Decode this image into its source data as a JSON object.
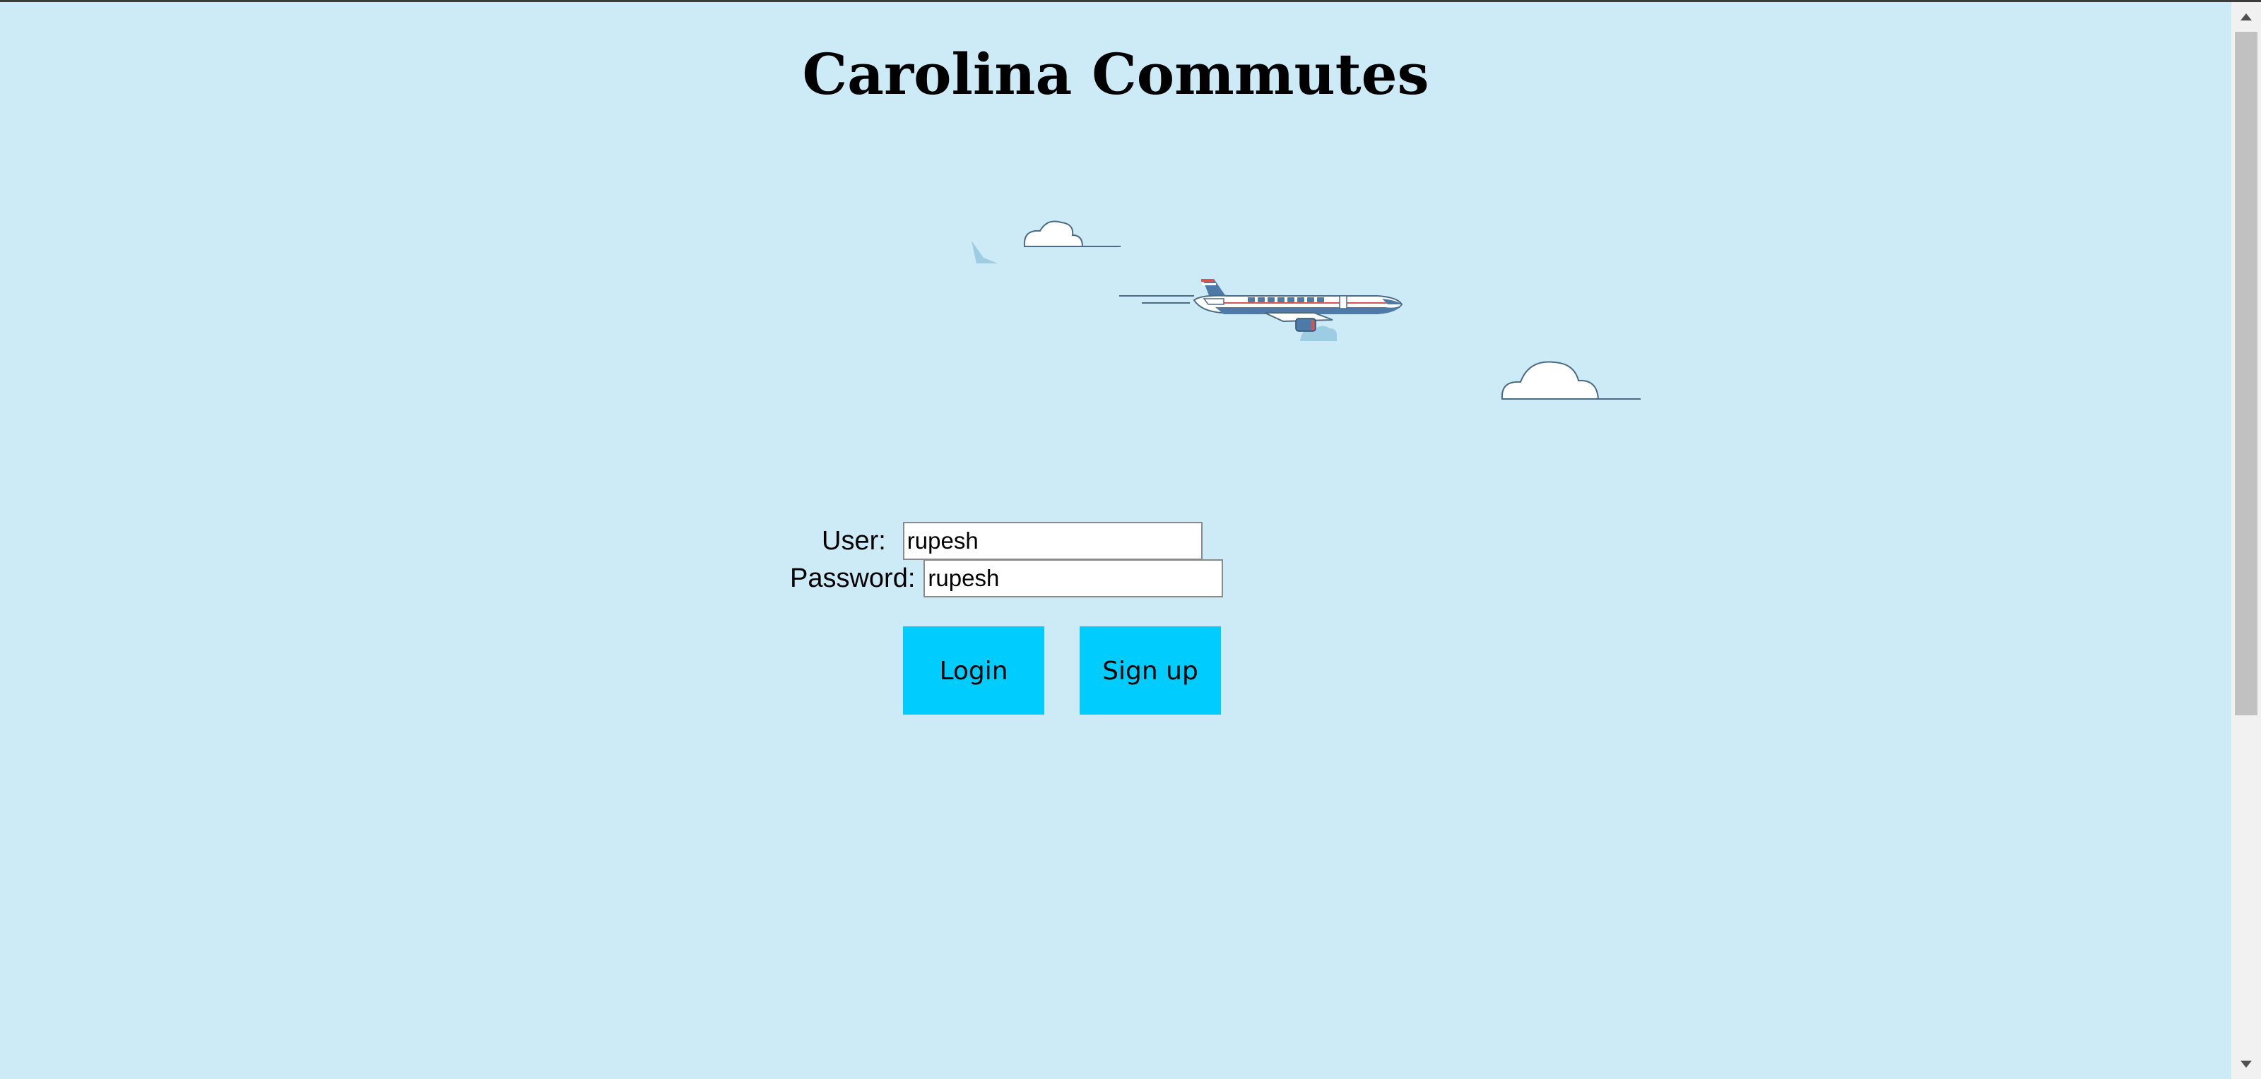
{
  "page": {
    "title": "Carolina Commutes",
    "background_color": "#cdeaf7"
  },
  "illustration": {
    "icons": [
      "bird-icon",
      "cloud-icon",
      "airplane-icon",
      "cloud-icon"
    ]
  },
  "login_form": {
    "user_label": "User:",
    "user_value": "rupesh",
    "password_label": "Password:",
    "password_value": "rupesh",
    "login_button": "Login",
    "signup_button": "Sign up",
    "button_color": "#00cdfd"
  },
  "scrollbar": {
    "up_icon": "scroll-up-arrow-icon",
    "down_icon": "scroll-down-arrow-icon"
  }
}
